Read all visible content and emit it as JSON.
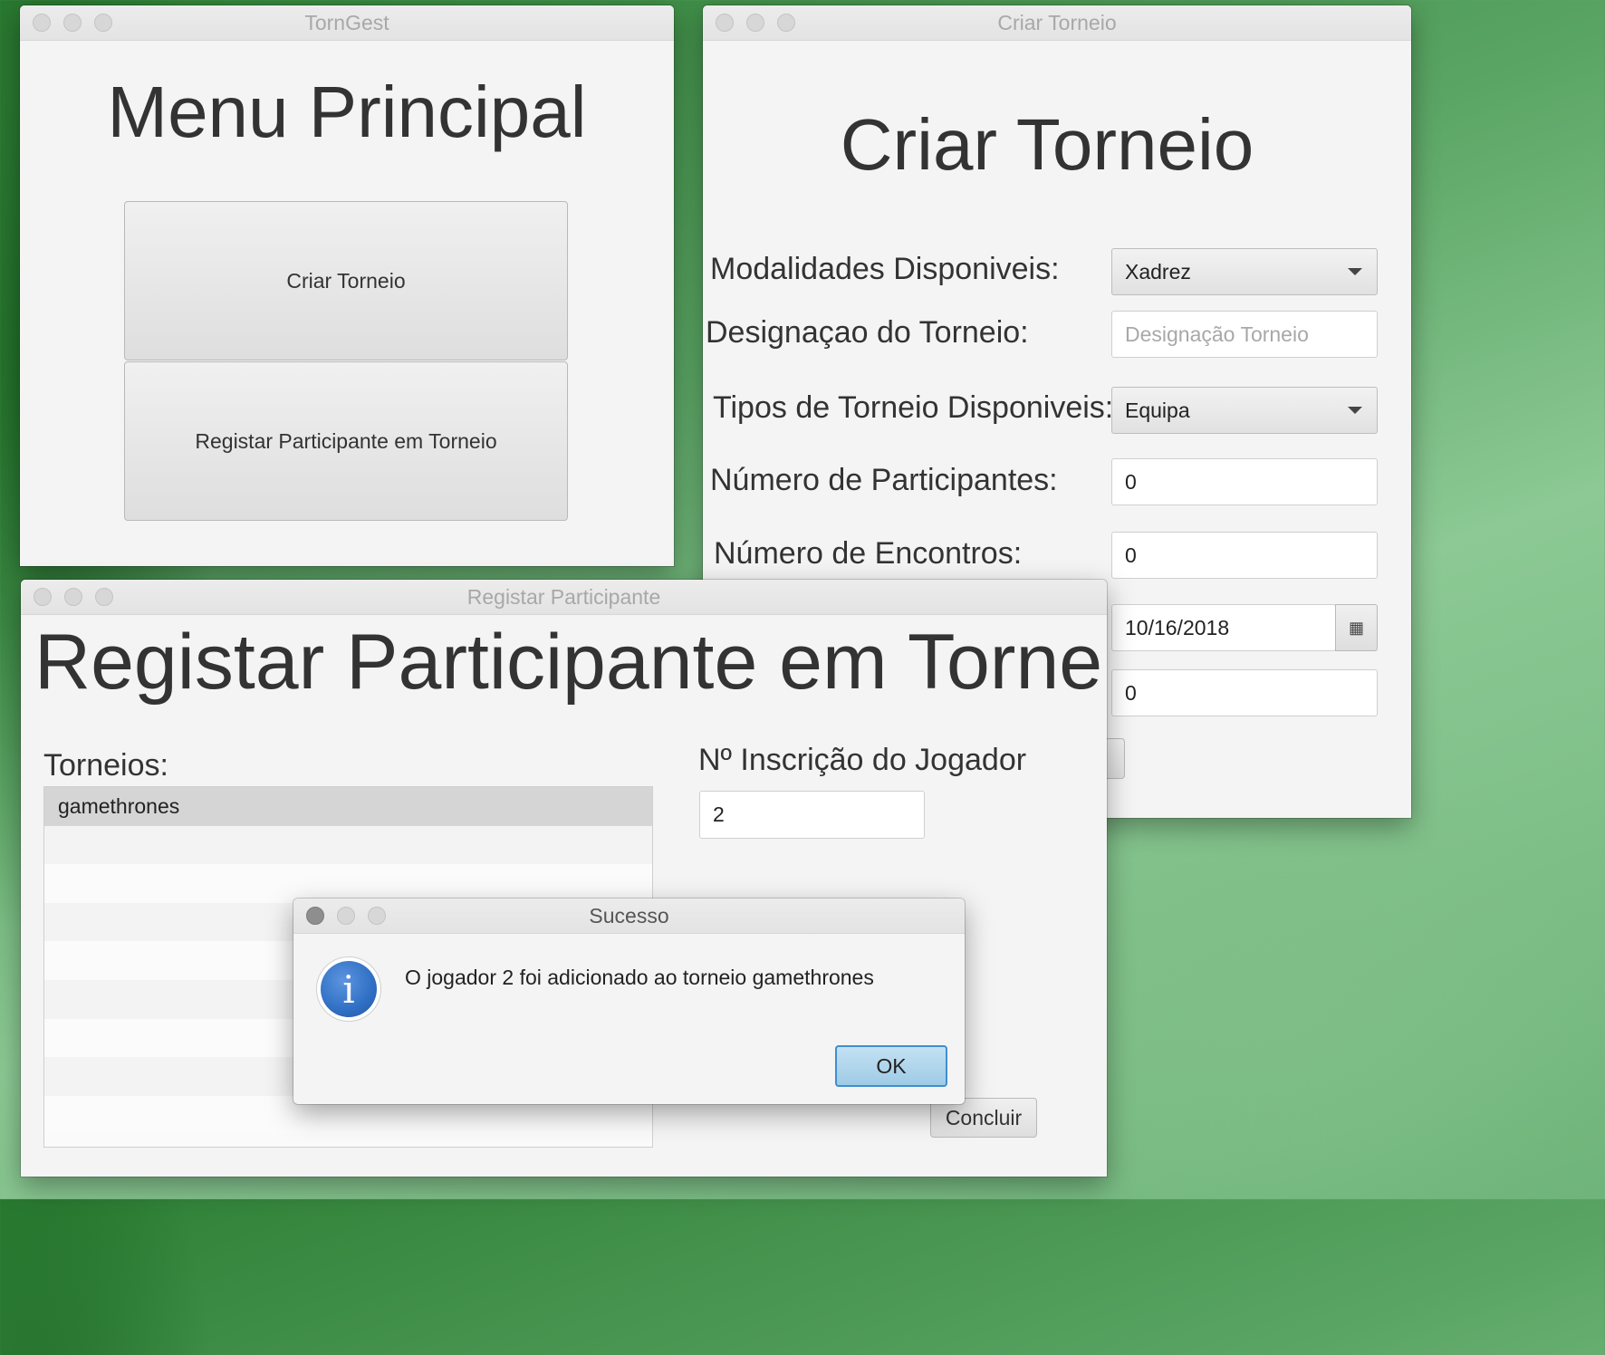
{
  "menu_window": {
    "title": "TornGest",
    "heading": "Menu Principal",
    "buttons": [
      "Criar Torneio",
      "Registar Participante em Torneio"
    ]
  },
  "create_window": {
    "title": "Criar Torneio",
    "heading": "Criar Torneio",
    "labels": {
      "modalidades": "Modalidades Disponiveis:",
      "designacao": "Designaçao do Torneio:",
      "tipos": "Tipos de Torneio Disponiveis:",
      "num_participantes": "Número de Participantes:",
      "num_encontros": "Número de Encontros:"
    },
    "modalidade_value": "Xadrez",
    "designacao_placeholder": "Designação Torneio",
    "tipo_value": "Equipa",
    "num_participantes_value": "0",
    "num_encontros_value": "0",
    "date_value": "10/16/2018",
    "extra_value": "0"
  },
  "register_window": {
    "title": "Registar Participante",
    "heading": "Registar Participante em Torneio",
    "torneios_label": "Torneios:",
    "torneios": [
      "gamethrones"
    ],
    "jogador_label": "Nº Inscrição do Jogador",
    "jogador_value": "2",
    "concluir_label": "Concluir"
  },
  "dialog": {
    "title": "Sucesso",
    "icon": "info-icon",
    "message": "O jogador 2 foi adicionado ao torneio gamethrones",
    "ok_label": "OK"
  },
  "colors": {
    "ok_button": "#a9d2ea",
    "info_icon": "#2f6fc4",
    "list_selected": "#d5d5d5"
  }
}
